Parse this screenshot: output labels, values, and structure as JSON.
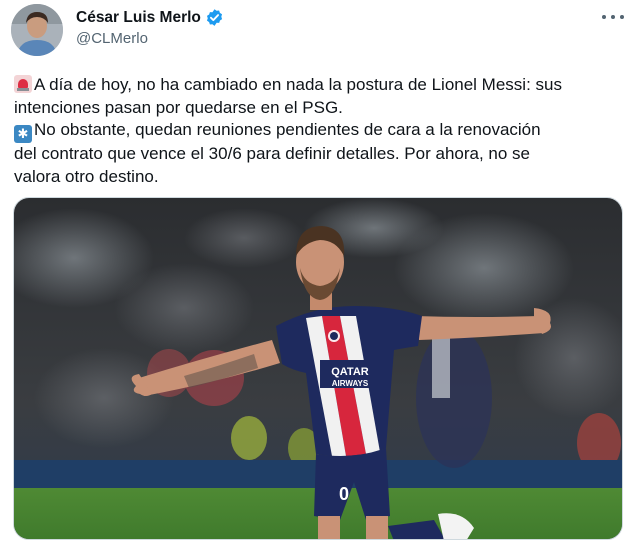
{
  "author": {
    "display_name": "César Luis Merlo",
    "handle": "@CLMerlo",
    "verified": true
  },
  "tweet": {
    "lines": [
      "A día de hoy, no ha cambiado en nada la postura de Lionel Messi: sus",
      "intenciones pasan por quedarse en el PSG.",
      "No obstante, quedan reuniones pendientes de cara a la renovación",
      "del contrato que vence el 30/6 para definir detalles. Por ahora, no se",
      "valora otro destino."
    ],
    "emoji_1": "police-car-light-emoji",
    "emoji_2": "asterisk-emoji"
  },
  "media": {
    "shirt_sponsor_line1": "QATAR",
    "shirt_sponsor_line2": "AIRWAYS",
    "shirt_number": "0"
  },
  "colors": {
    "text": "#0f1419",
    "secondary_text": "#536471",
    "verified_blue": "#1d9bf0",
    "border": "#cfd9de",
    "psg_navy": "#1e2a5e",
    "psg_red": "#d7263d",
    "pitch_green": "#3f7a2c"
  }
}
